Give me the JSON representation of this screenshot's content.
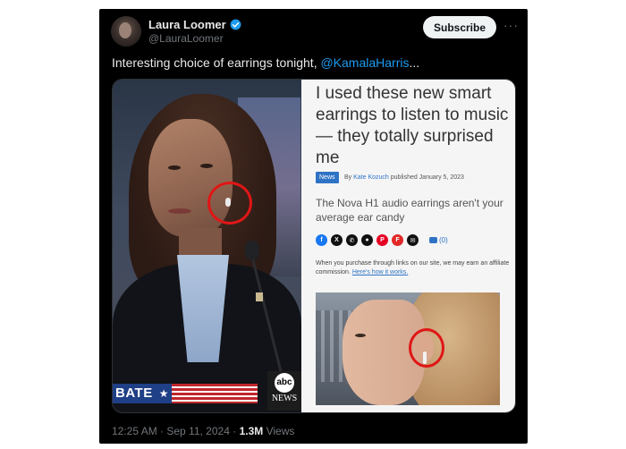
{
  "author": {
    "display_name": "Laura Loomer",
    "handle": "@LauraLoomer",
    "verified": true
  },
  "actions": {
    "subscribe_label": "Subscribe",
    "more_label": "···"
  },
  "tweet": {
    "text_prefix": "Interesting choice of earrings tonight, ",
    "mention": "@KamalaHarris",
    "text_suffix": "..."
  },
  "media": {
    "left_photo": {
      "debate_banner": "BATE",
      "debate_star": "★",
      "network_logo": "abc",
      "network_label": "NEWS"
    },
    "article": {
      "headline": "I used these new smart earrings to listen to music — they totally surprised me",
      "badge": "News",
      "byline_prefix": "By ",
      "author": "Kate Kozuch",
      "published": " published January 5, 2023",
      "subhead": "The Nova H1 audio earrings aren't your average ear candy",
      "share_icons": [
        {
          "name": "facebook-icon",
          "glyph": "f",
          "color": "#1877f2"
        },
        {
          "name": "x-icon",
          "glyph": "X",
          "color": "#111111"
        },
        {
          "name": "whatsapp-icon",
          "glyph": "✆",
          "color": "#111111"
        },
        {
          "name": "reddit-icon",
          "glyph": "●",
          "color": "#111111"
        },
        {
          "name": "pinterest-icon",
          "glyph": "P",
          "color": "#e60023"
        },
        {
          "name": "flipboard-icon",
          "glyph": "F",
          "color": "#e12828"
        },
        {
          "name": "email-icon",
          "glyph": "✉",
          "color": "#111111"
        }
      ],
      "comment_count": "(0)",
      "disclosure": "When you purchase through links on our site, we may earn an affiliate commission. ",
      "disclosure_link": "Here's how it works."
    }
  },
  "meta": {
    "time": "12:25 AM",
    "separator": " · ",
    "date": "Sep 11, 2024",
    "views_count": "1.3M",
    "views_label": " Views"
  },
  "colors": {
    "background": "#000000",
    "link_blue": "#1d9bf0",
    "highlight_red": "#e01616",
    "article_blue": "#2f73c5"
  }
}
